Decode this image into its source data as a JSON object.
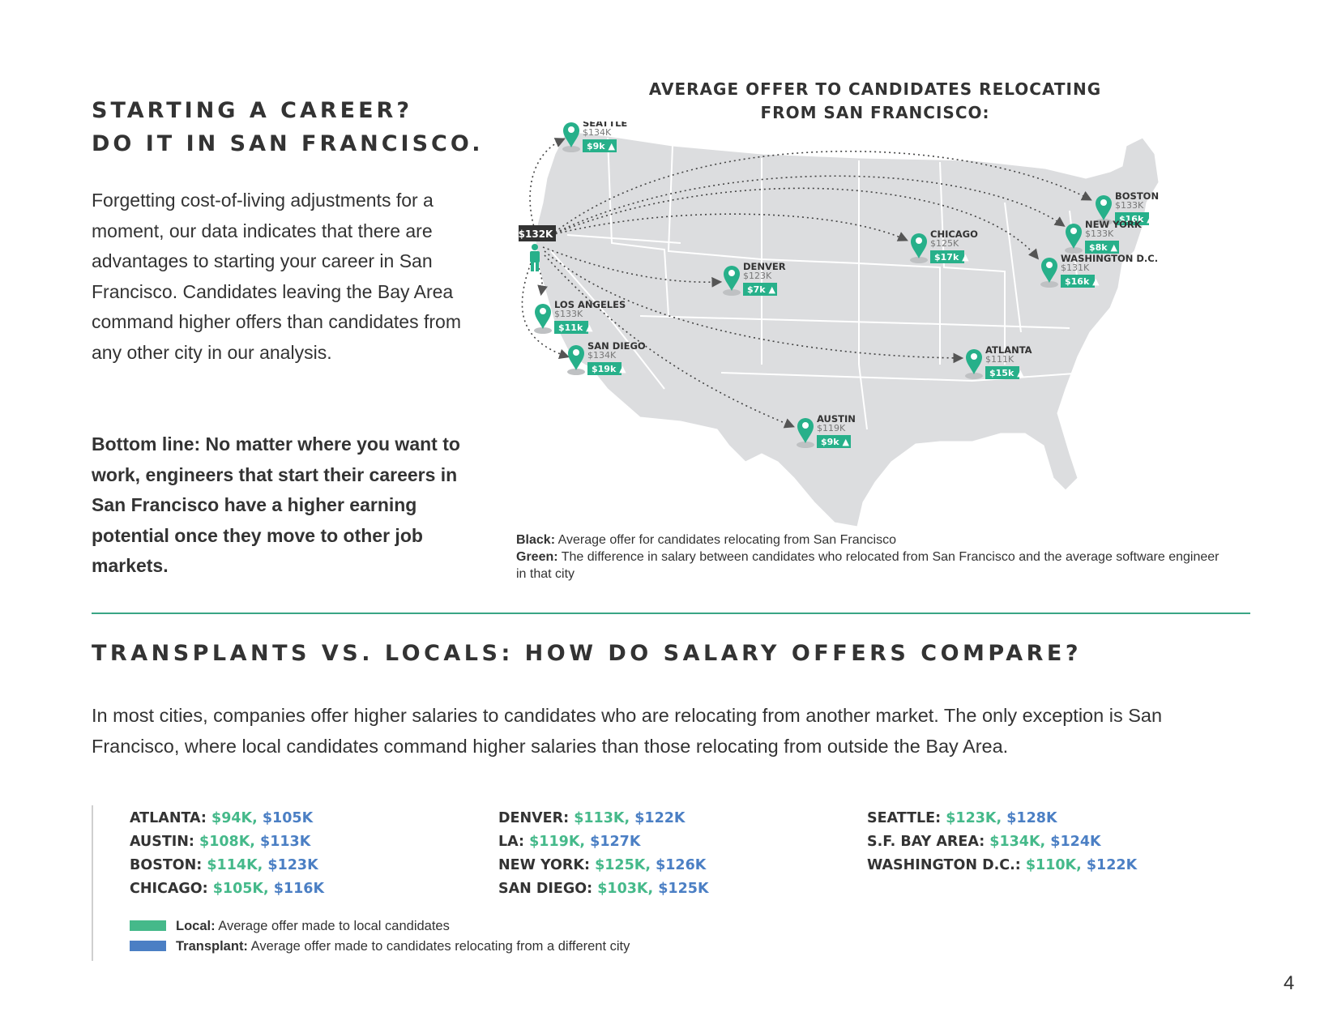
{
  "career": {
    "title_line1": "STARTING A CAREER?",
    "title_line2": "DO IT IN SAN FRANCISCO.",
    "body": "Forgetting cost-of-living adjustments for a moment, our data indicates that there are advantages to starting your career in San Francisco. Candidates leaving the Bay Area command higher offers than candidates from any other city in our analysis.",
    "bottom_line": "Bottom line: No matter where you want to work, engineers that start their careers in San Francisco have a higher earning potential once they move to other job markets."
  },
  "map": {
    "title_line1": "AVERAGE OFFER TO CANDIDATES RELOCATING",
    "title_line2": "FROM SAN FRANCISCO:",
    "origin_label": "$132K",
    "cities": [
      {
        "name": "SEATTLE",
        "offer": "$134K",
        "diff": "$9k"
      },
      {
        "name": "BOSTON",
        "offer": "$133K",
        "diff": "$16k"
      },
      {
        "name": "NEW YORK",
        "offer": "$133K",
        "diff": "$8k"
      },
      {
        "name": "CHICAGO",
        "offer": "$125K",
        "diff": "$17k"
      },
      {
        "name": "WASHINGTON D.C.",
        "offer": "$131K",
        "diff": "$16k"
      },
      {
        "name": "DENVER",
        "offer": "$123K",
        "diff": "$7k"
      },
      {
        "name": "LOS ANGELES",
        "offer": "$133K",
        "diff": "$11k"
      },
      {
        "name": "SAN DIEGO",
        "offer": "$134K",
        "diff": "$19k"
      },
      {
        "name": "ATLANTA",
        "offer": "$111K",
        "diff": "$15k"
      },
      {
        "name": "AUSTIN",
        "offer": "$119K",
        "diff": "$9k"
      }
    ],
    "legend": {
      "black_label": "Black:",
      "black_text": "Average offer for candidates relocating from San Francisco",
      "green_label": "Green:",
      "green_text": "The difference in salary between candidates who relocated from San Francisco and the average software engineer in that city"
    },
    "colors": {
      "pin": "#27b08a",
      "land": "#dcdddf",
      "origin": "#333333"
    }
  },
  "compare": {
    "title": "TRANSPLANTS VS. LOCALS: HOW DO SALARY OFFERS COMPARE?",
    "body": "In most cities, companies offer higher salaries to candidates who are relocating from another market. The only exception is San Francisco, where local candidates command higher salaries than those relocating from outside the Bay Area.",
    "columns": [
      [
        {
          "city": "ATLANTA:",
          "local": "$94K",
          "transplant": "$105K"
        },
        {
          "city": "AUSTIN:",
          "local": "$108K",
          "transplant": "$113K"
        },
        {
          "city": "BOSTON:",
          "local": "$114K",
          "transplant": "$123K"
        },
        {
          "city": "CHICAGO:",
          "local": "$105K",
          "transplant": "$116K"
        }
      ],
      [
        {
          "city": "DENVER:",
          "local": "$113K",
          "transplant": "$122K"
        },
        {
          "city": "LA:",
          "local": "$119K",
          "transplant": "$127K"
        },
        {
          "city": "NEW YORK:",
          "local": "$125K",
          "transplant": "$126K"
        },
        {
          "city": "SAN DIEGO:",
          "local": "$103K",
          "transplant": "$125K"
        }
      ],
      [
        {
          "city": "SEATTLE:",
          "local": "$123K",
          "transplant": "$128K"
        },
        {
          "city": "S.F. BAY AREA:",
          "local": "$134K",
          "transplant": "$124K"
        },
        {
          "city": "WASHINGTON D.C.:",
          "local": "$110K",
          "transplant": "$122K"
        }
      ]
    ],
    "legend": {
      "local_label": "Local:",
      "local_text": "Average offer made to local candidates",
      "transplant_label": "Transplant:",
      "transplant_text": "Average offer made to candidates relocating from a different city"
    },
    "colors": {
      "local": "#45b98a",
      "transplant": "#4b7fc4"
    }
  },
  "page_number": "4"
}
